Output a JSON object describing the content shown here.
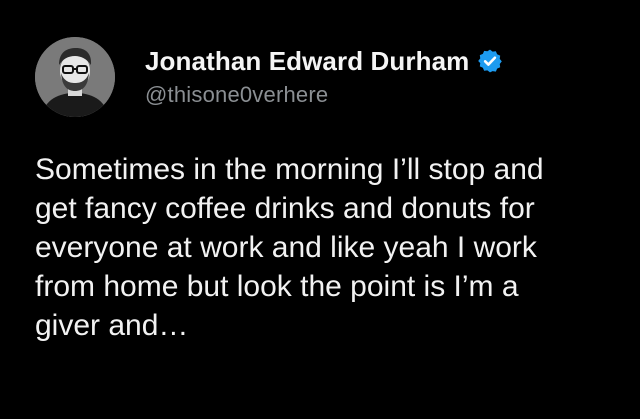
{
  "tweet": {
    "author": {
      "display_name": "Jonathan Edward Durham",
      "handle": "@thisone0verhere",
      "avatar_icon": "profile-photo-man-glasses",
      "verified_icon": "verified-badge-icon",
      "verified_color": "#1d9bf0"
    },
    "text": "Sometimes in the morning I’ll stop and\nget fancy coffee drinks and donuts for\neveryone at work and like yeah I work\nfrom home but look the point is I’m a\ngiver and…"
  },
  "colors": {
    "background": "#000000",
    "name": "#f5f5f5",
    "handle": "#8b8f93",
    "body": "#f2f2f2"
  }
}
